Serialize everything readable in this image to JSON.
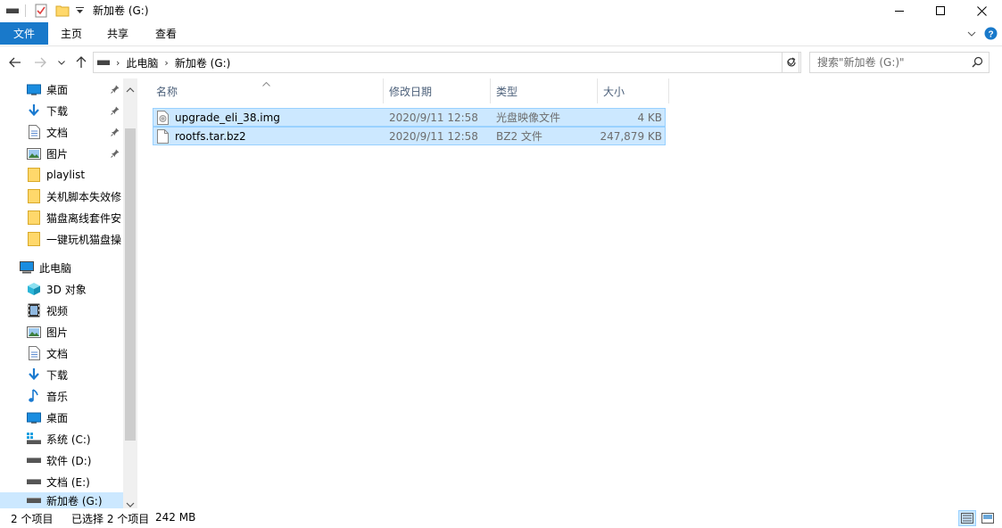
{
  "window": {
    "title": "新加卷 (G:)"
  },
  "ribbon": {
    "tabs": [
      {
        "label": "文件"
      },
      {
        "label": "主页"
      },
      {
        "label": "共享"
      },
      {
        "label": "查看"
      }
    ]
  },
  "address": {
    "breadcrumbs": [
      "此电脑",
      "新加卷 (G:)"
    ]
  },
  "search": {
    "placeholder": "搜索\"新加卷 (G:)\""
  },
  "nav": {
    "quick_access": [
      {
        "label": "桌面",
        "icon": "desktop-icon",
        "pinned": true
      },
      {
        "label": "下载",
        "icon": "download-icon",
        "pinned": true
      },
      {
        "label": "文档",
        "icon": "document-icon",
        "pinned": true
      },
      {
        "label": "图片",
        "icon": "picture-icon",
        "pinned": true
      },
      {
        "label": "playlist",
        "icon": "folder-icon",
        "pinned": false
      },
      {
        "label": "关机脚本失效修",
        "icon": "folder-icon",
        "pinned": false
      },
      {
        "label": "猫盘离线套件安",
        "icon": "folder-icon",
        "pinned": false
      },
      {
        "label": "一键玩机猫盘操",
        "icon": "folder-icon",
        "pinned": false
      }
    ],
    "this_pc": {
      "label": "此电脑",
      "icon": "computer-icon"
    },
    "pc_items": [
      {
        "label": "3D 对象",
        "icon": "3d-objects-icon"
      },
      {
        "label": "视频",
        "icon": "video-icon"
      },
      {
        "label": "图片",
        "icon": "picture-icon"
      },
      {
        "label": "文档",
        "icon": "document-icon"
      },
      {
        "label": "下载",
        "icon": "download-icon"
      },
      {
        "label": "音乐",
        "icon": "music-icon"
      },
      {
        "label": "桌面",
        "icon": "desktop-icon"
      },
      {
        "label": "系统 (C:)",
        "icon": "system-drive-icon"
      },
      {
        "label": "软件 (D:)",
        "icon": "drive-icon"
      },
      {
        "label": "文档 (E:)",
        "icon": "drive-icon"
      },
      {
        "label": "新加卷 (G:)",
        "icon": "drive-icon",
        "selected": true
      }
    ]
  },
  "columns": {
    "name": "名称",
    "modified": "修改日期",
    "type": "类型",
    "size": "大小"
  },
  "files": [
    {
      "name": "upgrade_eli_38.img",
      "modified": "2020/9/11 12:58",
      "type": "光盘映像文件",
      "size": "4 KB",
      "icon": "disc-image-file-icon"
    },
    {
      "name": "rootfs.tar.bz2",
      "modified": "2020/9/11 12:58",
      "type": "BZ2 文件",
      "size": "247,879 KB",
      "icon": "generic-file-icon"
    }
  ],
  "status": {
    "item_count": "2 个项目",
    "selection": "已选择 2 个项目",
    "selection_size": "242 MB"
  },
  "colors": {
    "accent": "#1979ca",
    "selection_bg": "#cce8ff",
    "selection_border": "#99d1ff",
    "header_text": "#4c607a",
    "muted_text": "#6d6d6d"
  }
}
